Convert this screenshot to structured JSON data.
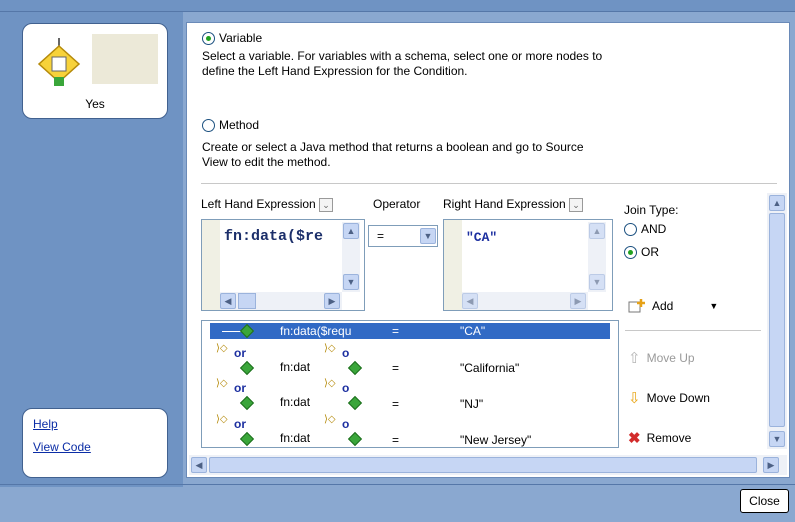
{
  "node": {
    "label": "Yes"
  },
  "links": {
    "help": "Help",
    "view_code": "View Code"
  },
  "options": {
    "variable_label": "Variable",
    "variable_desc_1": "Select a variable. For variables with a schema, select one or more nodes to",
    "variable_desc_2": "define the Left Hand Expression for the Condition.",
    "method_label": "Method",
    "method_desc_1": "Create or select a Java method that returns a boolean and go to Source",
    "method_desc_2": "View to edit the method."
  },
  "editor": {
    "lhs_label": "Left Hand Expression",
    "operator_label": "Operator",
    "rhs_label": "Right Hand Expression",
    "lhs_value": "fn:data($re",
    "operator_value": "=",
    "rhs_value": "\"CA\""
  },
  "join": {
    "label": "Join Type:",
    "and": "AND",
    "or": "OR"
  },
  "actions": {
    "add": "Add",
    "move_up": "Move Up",
    "move_down": "Move Down",
    "remove": "Remove"
  },
  "conditions": [
    {
      "lhs": "fn:data($requ",
      "op": "=",
      "rhs": "\"CA\""
    },
    {
      "join": "or",
      "join2": "o",
      "lhs": "fn:dat",
      "op": "=",
      "rhs": "\"California\""
    },
    {
      "join": "or",
      "join2": "o",
      "lhs": "fn:dat",
      "op": "=",
      "rhs": "\"NJ\""
    },
    {
      "join": "or",
      "join2": "o",
      "lhs": "fn:dat",
      "op": "=",
      "rhs": "\"New Jersey\""
    }
  ],
  "footer": {
    "close": "Close"
  }
}
